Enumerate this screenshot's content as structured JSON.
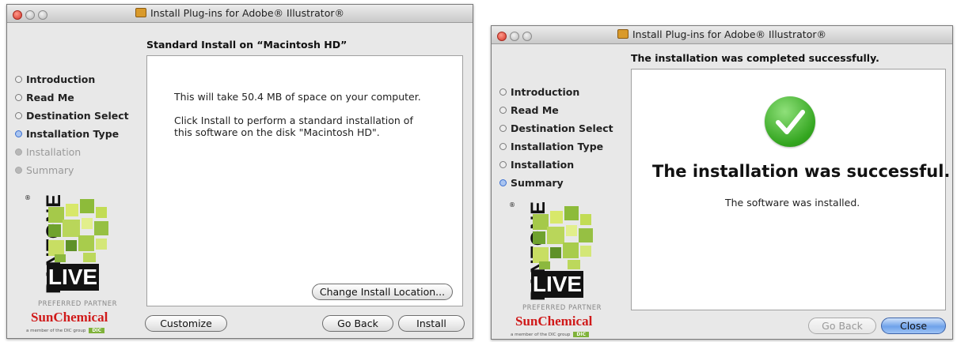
{
  "window1": {
    "title": "Install Plug-ins for Adobe® Illustrator®",
    "heading": "Standard Install on “Macintosh HD”",
    "steps": [
      {
        "label": "Introduction",
        "state": "done"
      },
      {
        "label": "Read Me",
        "state": "done"
      },
      {
        "label": "Destination Select",
        "state": "done"
      },
      {
        "label": "Installation Type",
        "state": "current"
      },
      {
        "label": "Installation",
        "state": "pending"
      },
      {
        "label": "Summary",
        "state": "pending"
      }
    ],
    "body_line1": "This will take 50.4 MB of space on your computer.",
    "body_line2": "Click Install to perform a standard installation of",
    "body_line3": "this software on the disk \"Macintosh HD\".",
    "change_location_label": "Change Install Location...",
    "customize_label": "Customize",
    "go_back_label": "Go Back",
    "install_label": "Install"
  },
  "window2": {
    "title": "Install Plug-ins for Adobe® Illustrator®",
    "heading": "The installation was completed successfully.",
    "steps": [
      {
        "label": "Introduction",
        "state": "done"
      },
      {
        "label": "Read Me",
        "state": "done"
      },
      {
        "label": "Destination Select",
        "state": "done"
      },
      {
        "label": "Installation Type",
        "state": "done"
      },
      {
        "label": "Installation",
        "state": "done"
      },
      {
        "label": "Summary",
        "state": "current"
      }
    ],
    "success_title": "The installation was successful.",
    "success_detail": "The software was installed.",
    "go_back_label": "Go Back",
    "close_label": "Close"
  },
  "branding": {
    "pantone": "PANTONE",
    "registered": "®",
    "live": "LIVE",
    "preferred_partner": "PREFERRED PARTNER",
    "sunchemical": "SunChemical",
    "member_text": "a member of the DIC group",
    "dic": "DIC"
  },
  "icons": [
    "package-icon",
    "check-icon",
    "step-bullet-icon"
  ],
  "colors": {
    "accent_blue": "#3a6fd1",
    "check_green": "#33a51f",
    "sun_red": "#d01a1a"
  }
}
